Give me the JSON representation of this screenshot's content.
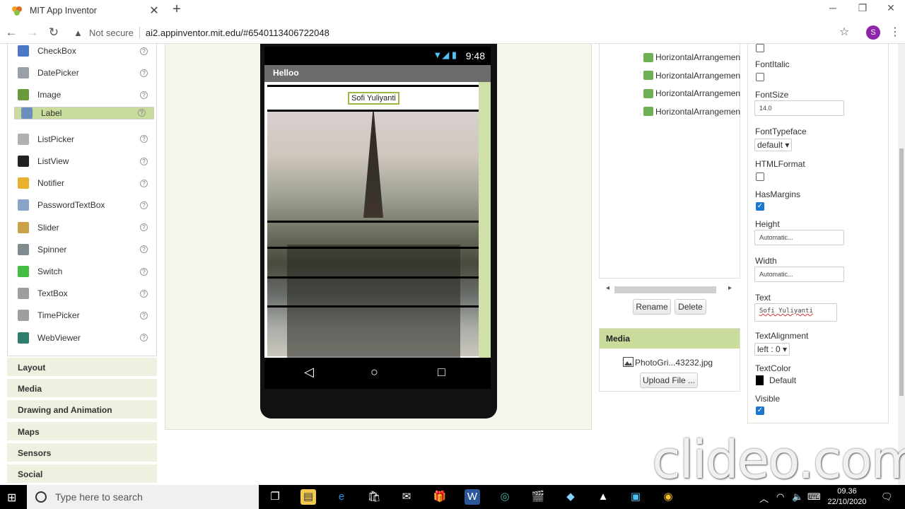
{
  "browser": {
    "tab_title": "MIT App Inventor",
    "tab_close": "✕",
    "new_tab": "+",
    "not_secure": "Not secure",
    "url": "ai2.appinventor.mit.edu/#6540113406722048",
    "avatar_letter": "S",
    "min": "─",
    "max": "❐",
    "close": "✕"
  },
  "palette": {
    "items": [
      {
        "label": "CheckBox",
        "icon": "checkbox-icon",
        "color": "#4a78c8"
      },
      {
        "label": "DatePicker",
        "icon": "datepicker-icon",
        "color": "#9aa0a6"
      },
      {
        "label": "Image",
        "icon": "image-icon",
        "color": "#6b9a3a"
      },
      {
        "label": "Label",
        "icon": "label-icon",
        "color": "#6d8fbf"
      },
      {
        "label": "ListPicker",
        "icon": "listpicker-icon",
        "color": "#b0b0b0"
      },
      {
        "label": "ListView",
        "icon": "listview-icon",
        "color": "#222222"
      },
      {
        "label": "Notifier",
        "icon": "notifier-icon",
        "color": "#e8b22e"
      },
      {
        "label": "PasswordTextBox",
        "icon": "password-icon",
        "color": "#8aa4c8"
      },
      {
        "label": "Slider",
        "icon": "slider-icon",
        "color": "#caa24a"
      },
      {
        "label": "Spinner",
        "icon": "spinner-icon",
        "color": "#7f8c8d"
      },
      {
        "label": "Switch",
        "icon": "switch-icon",
        "color": "#43c043"
      },
      {
        "label": "TextBox",
        "icon": "textbox-icon",
        "color": "#9e9e9e"
      },
      {
        "label": "TimePicker",
        "icon": "timepicker-icon",
        "color": "#9e9e9e"
      },
      {
        "label": "WebViewer",
        "icon": "webviewer-icon",
        "color": "#2f7d6b"
      }
    ],
    "help": "?",
    "categories": [
      "Layout",
      "Media",
      "Drawing and Animation",
      "Maps",
      "Sensors",
      "Social"
    ]
  },
  "phone": {
    "time": "9:48",
    "signal": "▼◢ ▮",
    "title": "Helloo",
    "label_text": "Sofi Yuliyanti",
    "nav_back": "◁",
    "nav_home": "○",
    "nav_recent": "□"
  },
  "components": {
    "items": [
      "HorizontalArrangemen",
      "HorizontalArrangemen",
      "HorizontalArrangemen",
      "HorizontalArrangemen"
    ],
    "rename": "Rename",
    "delete": "Delete",
    "scroll_left": "◂",
    "scroll_right": "▸"
  },
  "media": {
    "title": "Media",
    "file": "PhotoGri...43232.jpg",
    "upload": "Upload File ..."
  },
  "properties": {
    "font_italic": "FontItalic",
    "font_size": "FontSize",
    "font_size_value": "14.0",
    "font_typeface": "FontTypeface",
    "font_typeface_value": "default ▾",
    "html_format": "HTMLFormat",
    "has_margins": "HasMargins",
    "height": "Height",
    "height_value": "Automatic...",
    "width": "Width",
    "width_value": "Automatic...",
    "text": "Text",
    "text_value": "Sofi Yuliyanti",
    "text_alignment": "TextAlignment",
    "text_alignment_value": "left : 0 ▾",
    "text_color": "TextColor",
    "text_color_value": "Default",
    "visible": "Visible",
    "check": "✓"
  },
  "watermark": "clideo.com",
  "taskbar": {
    "search_placeholder": "Type here to search",
    "time": "09.36",
    "date": "22/10/2020"
  }
}
